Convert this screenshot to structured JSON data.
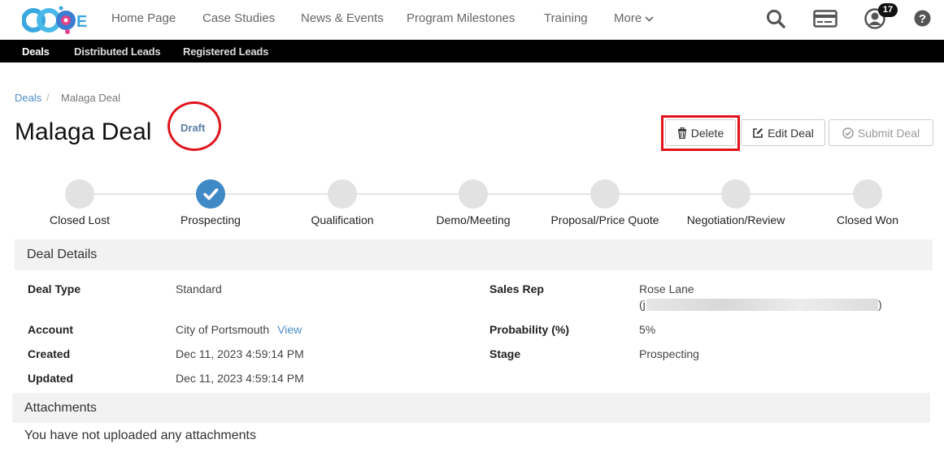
{
  "nav": {
    "logo_text": "CCoE",
    "links": [
      "Home Page",
      "Case Studies",
      "News & Events",
      "Program Milestones",
      "Training"
    ],
    "more_label": "More",
    "notification_count": "17"
  },
  "subnav": {
    "items": [
      "Deals",
      "Distributed Leads",
      "Registered Leads"
    ]
  },
  "breadcrumb": {
    "parent": "Deals",
    "separator": "/",
    "current": "Malaga Deal"
  },
  "page": {
    "title": "Malaga Deal",
    "status": "Draft"
  },
  "actions": {
    "delete_label": "Delete",
    "edit_label": "Edit Deal",
    "submit_label": "Submit Deal"
  },
  "stages": {
    "labels": [
      "Closed Lost",
      "Prospecting",
      "Qualification",
      "Demo/Meeting",
      "Proposal/Price Quote",
      "Negotiation/Review",
      "Closed Won"
    ],
    "active": "Prospecting"
  },
  "details": {
    "heading": "Deal Details",
    "deal_type_label": "Deal Type",
    "deal_type": "Standard",
    "account_label": "Account",
    "account": "City of Portsmouth",
    "account_view": "View",
    "created_label": "Created",
    "created": "Dec 11, 2023 4:59:14 PM",
    "updated_label": "Updated",
    "updated": "Dec 11, 2023 4:59:14 PM",
    "sales_rep_label": "Sales Rep",
    "sales_rep": "Rose Lane",
    "sales_rep_email_open": "(j",
    "sales_rep_email_close": ")",
    "probability_label": "Probability (%)",
    "probability": "5%",
    "stage_label": "Stage",
    "stage": "Prospecting"
  },
  "attachments": {
    "heading": "Attachments",
    "empty_message": "You have not uploaded any attachments"
  },
  "colors": {
    "accent": "#3f89c6",
    "link": "#4f8ec9",
    "highlight": "#e0141c"
  }
}
